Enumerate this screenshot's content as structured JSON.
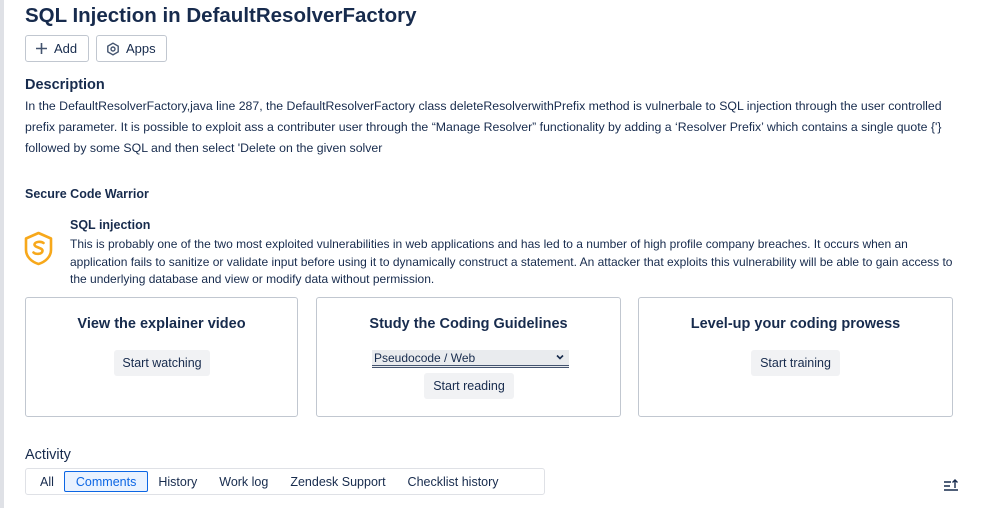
{
  "issue": {
    "title": "SQL Injection in DefaultResolverFactory"
  },
  "toolbar": {
    "add_label": "Add",
    "apps_label": "Apps"
  },
  "description": {
    "heading": "Description",
    "body": "In the DefaultResolverFactory,java line 287, the DefaultResolverFactory class deleteResolverwithPrefix method is vulnerbale to SQL injection through the user controlled prefix parameter. It is possible to exploit ass a contributer user through the “Manage Resolver” functionality by adding a ‘Resolver Prefix’ which contains a single quote {'} followed by some SQL and then select 'Delete on the given solver"
  },
  "secure_code_warrior": {
    "heading": "Secure Code Warrior",
    "vuln_title": "SQL injection",
    "vuln_text": "This is probably one of the two most exploited vulnerabilities in web applications and has led to a number of high profile company breaches. It occurs when an application fails to sanitize or validate input before using it to dynamically construct a statement. An attacker that exploits this vulnerability will be able to gain access to the underlying database and view or modify data without permission.",
    "logo_color": "#f7a81b",
    "cards": [
      {
        "title": "View the explainer video",
        "button": "Start watching"
      },
      {
        "title": "Study the Coding Guidelines",
        "select_value": "Pseudocode / Web",
        "button": "Start reading"
      },
      {
        "title": "Level-up your coding prowess",
        "button": "Start training"
      }
    ]
  },
  "activity": {
    "heading": "Activity",
    "tabs": [
      "All",
      "Comments",
      "History",
      "Work log",
      "Zendesk Support",
      "Checklist history"
    ],
    "active_tab": "Comments",
    "accent_color": "#0c66e4"
  },
  "icons": [
    "plus-icon",
    "apps-icon",
    "scw-logo-icon",
    "chevron-down-icon",
    "sort-icon"
  ]
}
